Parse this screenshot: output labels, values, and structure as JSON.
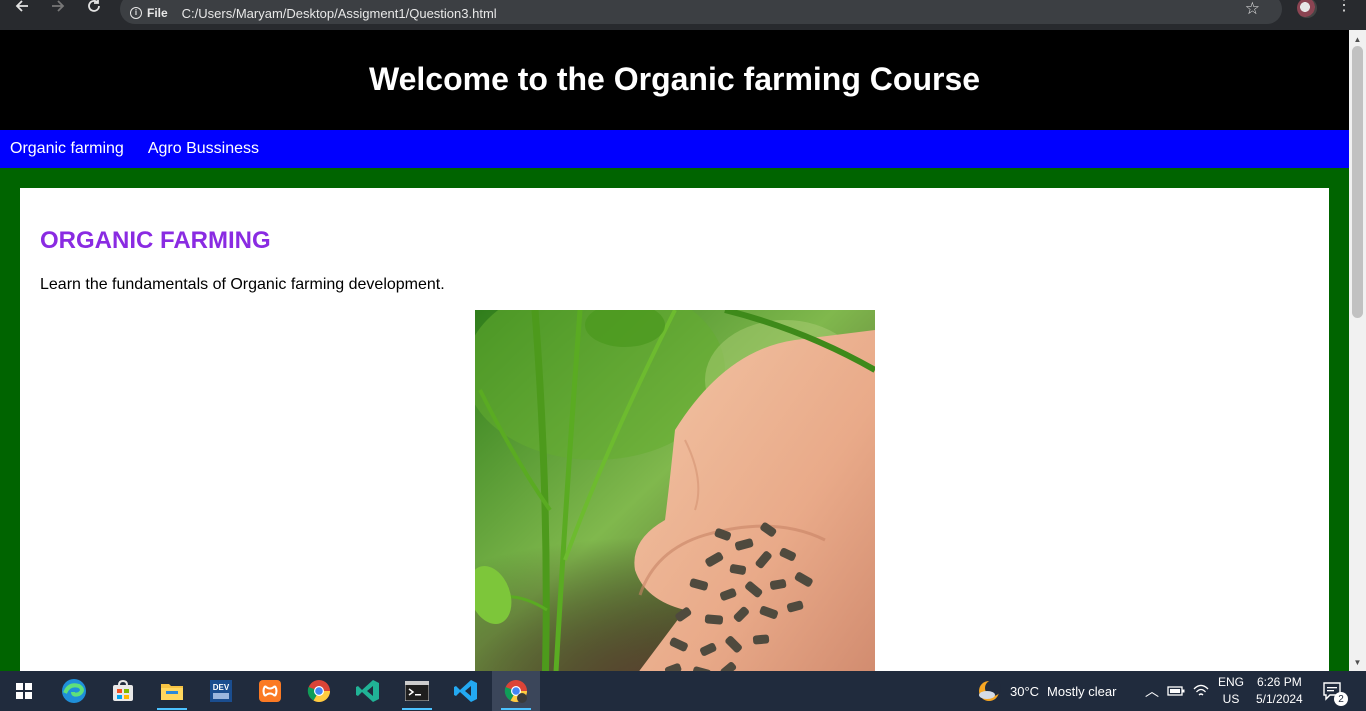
{
  "browser": {
    "site_chip": "File",
    "url": "C:/Users/Maryam/Desktop/Assigment1/Question3.html"
  },
  "page": {
    "header_title": "Welcome to the Organic farming Course",
    "nav": [
      {
        "label": "Organic farming"
      },
      {
        "label": "Agro Bussiness"
      }
    ],
    "section_title": "ORGANIC FARMING",
    "section_text": "Learn the fundamentals of Organic farming development."
  },
  "taskbar": {
    "weather_temp": "30°C",
    "weather_text": "Mostly clear",
    "lang_top": "ENG",
    "lang_bottom": "US",
    "time": "6:26 PM",
    "date": "5/1/2024",
    "notification_count": "2"
  },
  "colors": {
    "page_background": "#006400",
    "header_background": "#000000",
    "nav_background": "#0000ff",
    "section_title": "#8a2be2"
  },
  "icons": [
    "back-icon",
    "forward-icon",
    "reload-icon",
    "info-icon",
    "star-icon",
    "profile-avatar",
    "menu-icon",
    "windows-start-icon",
    "edge-icon",
    "store-icon",
    "file-explorer-icon",
    "dev-cpp-icon",
    "xampp-icon",
    "chrome-icon",
    "visual-studio-icon",
    "terminal-icon",
    "vscode-icon",
    "chrome-active-icon",
    "weather-icon",
    "chevron-up-icon",
    "battery-icon",
    "wifi-icon",
    "notifications-icon"
  ]
}
